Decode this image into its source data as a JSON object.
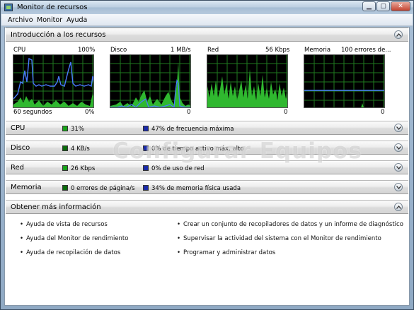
{
  "window": {
    "title": "Monitor de recursos"
  },
  "menu": [
    "Archivo",
    "Monitor",
    "Ayuda"
  ],
  "overview": {
    "title": "Introducción a los recursos",
    "graphs": [
      {
        "name": "CPU",
        "max": "100%",
        "bottom_left": "60 segundos",
        "bottom_right": "0%"
      },
      {
        "name": "Disco",
        "max": "1 MB/s",
        "bottom_left": "",
        "bottom_right": "0"
      },
      {
        "name": "Red",
        "max": "56 Kbps",
        "bottom_left": "",
        "bottom_right": "0"
      },
      {
        "name": "Memoria",
        "max": "100 errores de...",
        "bottom_left": "",
        "bottom_right": "0"
      }
    ]
  },
  "sections": [
    {
      "title": "CPU",
      "metric1": "31%",
      "metric2": "47% de frecuencia máxima",
      "color1": "#1aa21a",
      "color2": "#1a2aa8"
    },
    {
      "title": "Disco",
      "metric1": "4 KB/s",
      "metric2": "0% de tiempo activo máx. alto",
      "color1": "#0c6a0c",
      "color2": "#1a2aa8"
    },
    {
      "title": "Red",
      "metric1": "26 Kbps",
      "metric2": "0% de uso de red",
      "color1": "#1aa21a",
      "color2": "#1a2aa8"
    },
    {
      "title": "Memoria",
      "metric1": "0 errores de página/s",
      "metric2": "34% de memoria física usada",
      "color1": "#0c6a0c",
      "color2": "#1a2aa8"
    }
  ],
  "more_info": {
    "title": "Obtener más información",
    "links_left": [
      "Ayuda de vista de recursos",
      "Ayuda del Monitor de rendimiento",
      "Ayuda de recopilación de datos"
    ],
    "links_right": [
      "Crear un conjunto de recopiladores de datos y un informe de diagnóstico",
      "Supervisar la actividad del sistema con el Monitor de rendimiento",
      "Programar y administrar datos"
    ]
  },
  "watermark": "Configurar Equipos",
  "colors": {
    "graph_bg": "#000000",
    "grid": "#1f7a1f",
    "series_green": "#3ddc3d",
    "series_blue": "#4a7cff"
  }
}
